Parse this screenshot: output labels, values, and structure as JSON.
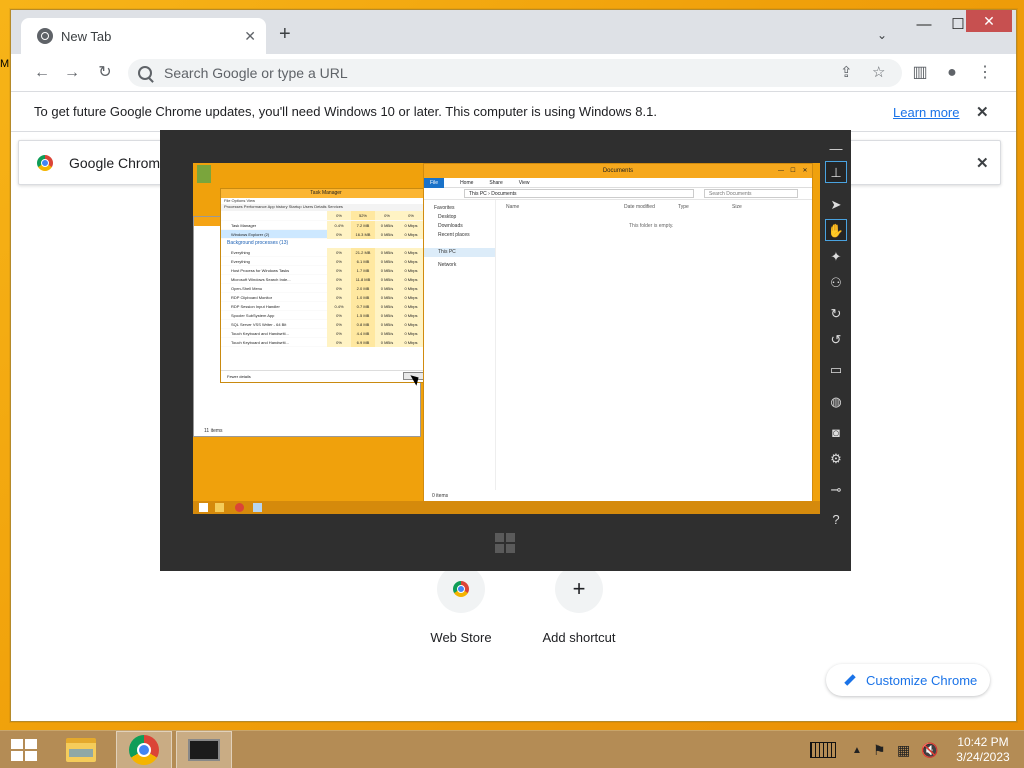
{
  "desktop": {
    "stray_text": "M"
  },
  "browser": {
    "tab": {
      "title": "New Tab"
    },
    "omnibox": {
      "placeholder": "Search Google or type a URL"
    },
    "infobar": {
      "message": "To get future Google Chrome updates, you'll need Windows 10 or later. This computer is using Windows 8.1.",
      "link": "Learn more"
    },
    "notification": {
      "text": "Google Chrome"
    },
    "shortcuts": [
      {
        "label": "Web Store"
      },
      {
        "label": "Add shortcut"
      }
    ],
    "customize_label": "Customize Chrome"
  },
  "remote_viewer": {
    "sidebar_icons": [
      "minimize-icon",
      "pin-icon",
      "pointer-icon",
      "hand-icon",
      "magic-icon",
      "group-icon",
      "rotate-icon",
      "rotate-back-icon",
      "monitor-icon",
      "globe-icon",
      "camera-icon",
      "gear-icon",
      "plug-icon",
      "help-icon"
    ],
    "remote_screen": {
      "task_manager": {
        "title": "Task Manager",
        "menu": "File  Options  View",
        "tabs": "Processes  Performance  App history  Startup  Users  Details  Services",
        "header": {
          "cpu": "0%",
          "memory": "52%",
          "disk": "0%",
          "network": "0%"
        },
        "apps": [
          {
            "name": "Task Manager",
            "cpu": "0.4%",
            "mem": "7.2 MB",
            "disk": "0 MB/s",
            "net": "0 Mbps"
          },
          {
            "name": "Windows Explorer (2)",
            "cpu": "0%",
            "mem": "16.3 MB",
            "disk": "0 MB/s",
            "net": "0 Mbps"
          }
        ],
        "background_group": "Background processes (13)",
        "background": [
          {
            "name": "Everything",
            "cpu": "0%",
            "mem": "21.2 MB",
            "disk": "0 MB/s",
            "net": "0 Mbps"
          },
          {
            "name": "Everything",
            "cpu": "0%",
            "mem": "6.1 MB",
            "disk": "0 MB/s",
            "net": "0 Mbps"
          },
          {
            "name": "Host Process for Windows Tasks",
            "cpu": "0%",
            "mem": "1.7 MB",
            "disk": "0 MB/s",
            "net": "0 Mbps"
          },
          {
            "name": "Microsoft Windows Search Inde...",
            "cpu": "0%",
            "mem": "11.8 MB",
            "disk": "0 MB/s",
            "net": "0 Mbps"
          },
          {
            "name": "Open-Shell Menu",
            "cpu": "0%",
            "mem": "2.0 MB",
            "disk": "0 MB/s",
            "net": "0 Mbps"
          },
          {
            "name": "RDP Clipboard Monitor",
            "cpu": "0%",
            "mem": "1.0 MB",
            "disk": "0 MB/s",
            "net": "0 Mbps"
          },
          {
            "name": "RDP Session Input Handler",
            "cpu": "0.4%",
            "mem": "0.7 MB",
            "disk": "0 MB/s",
            "net": "0 Mbps"
          },
          {
            "name": "Spooler SubSystem App",
            "cpu": "0%",
            "mem": "1.5 MB",
            "disk": "0 MB/s",
            "net": "0 Mbps"
          },
          {
            "name": "SQL Server VSS Writer - 64 Bit",
            "cpu": "0%",
            "mem": "0.8 MB",
            "disk": "0 MB/s",
            "net": "0 Mbps"
          },
          {
            "name": "Touch Keyboard and Handwriti...",
            "cpu": "0%",
            "mem": "4.4 MB",
            "disk": "0 MB/s",
            "net": "0 Mbps"
          },
          {
            "name": "Touch Keyboard and Handwriti...",
            "cpu": "0%",
            "mem": "6.9 MB",
            "disk": "0 MB/s",
            "net": "0 Mbps"
          }
        ],
        "fewer_details": "Fewer details"
      },
      "explorer_behind": {
        "status": "11 items"
      },
      "documents": {
        "title": "Documents",
        "ribbon": [
          "File",
          "Home",
          "Share",
          "View"
        ],
        "path": "This PC  ›  Documents",
        "search_placeholder": "Search Documents",
        "nav": [
          "Favorites",
          "Desktop",
          "Downloads",
          "Recent places",
          "This PC",
          "Network"
        ],
        "columns": [
          "Name",
          "Date modified",
          "Type",
          "Size"
        ],
        "empty_text": "This folder is empty.",
        "status": "0 items"
      }
    }
  },
  "taskbar": {
    "clock": {
      "time": "10:42 PM",
      "date": "3/24/2023"
    }
  }
}
